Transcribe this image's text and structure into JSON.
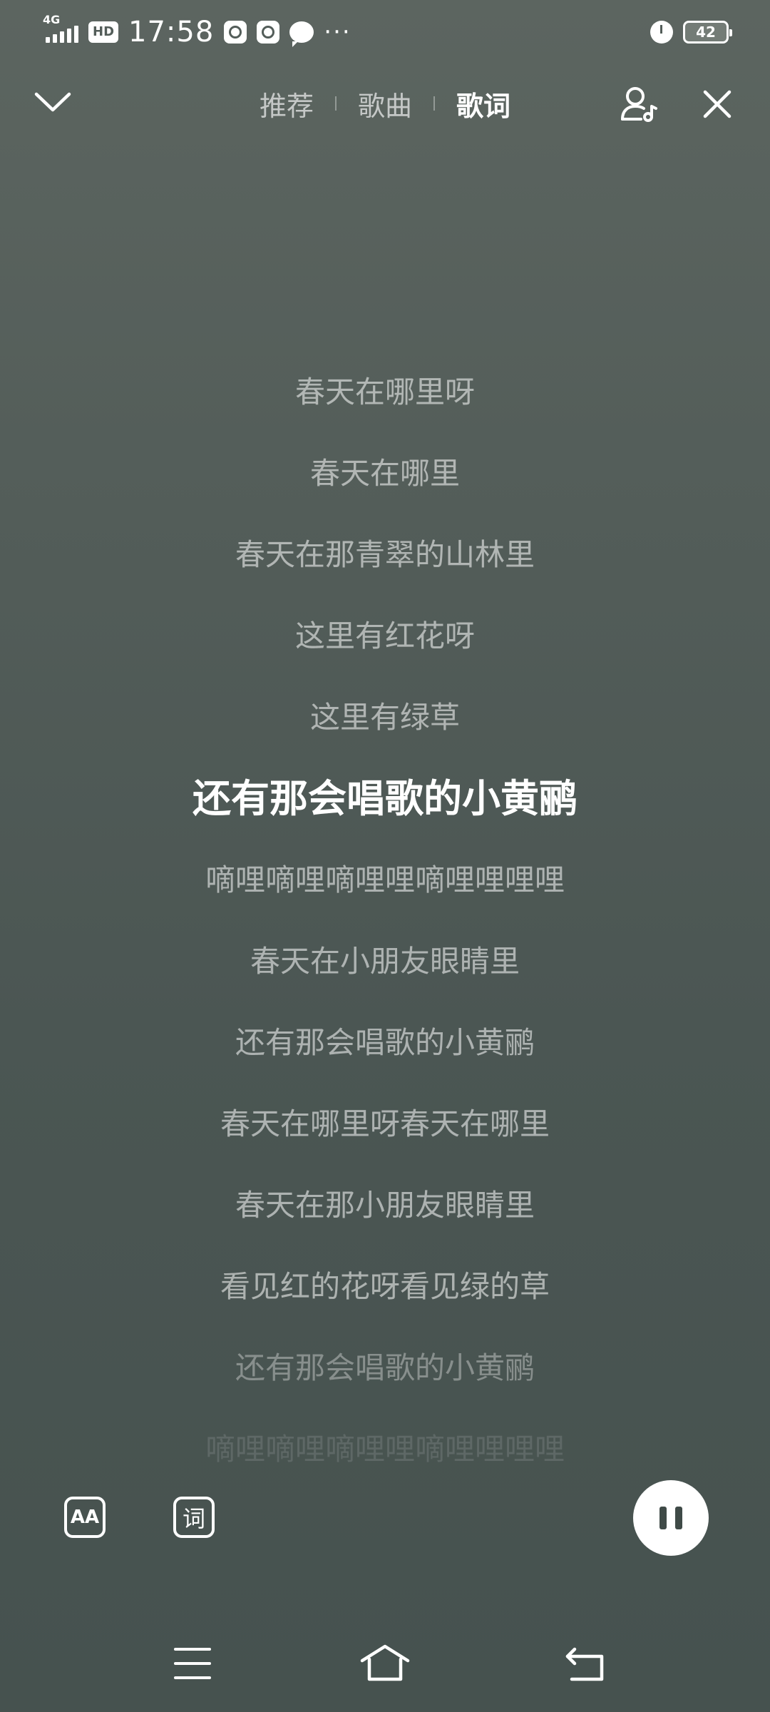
{
  "status_bar": {
    "network": "4G",
    "hd": "HD",
    "time": "17:58",
    "more": "···",
    "battery": "42"
  },
  "header": {
    "tabs": [
      {
        "label": "推荐",
        "active": false
      },
      {
        "label": "歌曲",
        "active": false
      },
      {
        "label": "歌词",
        "active": true
      }
    ]
  },
  "lyrics": {
    "lines": [
      "春天在哪里呀",
      "春天在哪里",
      "春天在那青翠的山林里",
      "这里有红花呀",
      "这里有绿草",
      "还有那会唱歌的小黄鹂",
      "嘀哩嘀哩嘀哩哩嘀哩哩哩哩",
      "春天在小朋友眼睛里",
      "还有那会唱歌的小黄鹂",
      "春天在哪里呀春天在哪里",
      "春天在那小朋友眼睛里",
      "看见红的花呀看见绿的草",
      "还有那会唱歌的小黄鹂",
      "嘀哩嘀哩嘀哩哩嘀哩哩哩哩"
    ],
    "current_index": 5
  },
  "controls": {
    "font_label": "AA",
    "lyric_label": "词"
  }
}
